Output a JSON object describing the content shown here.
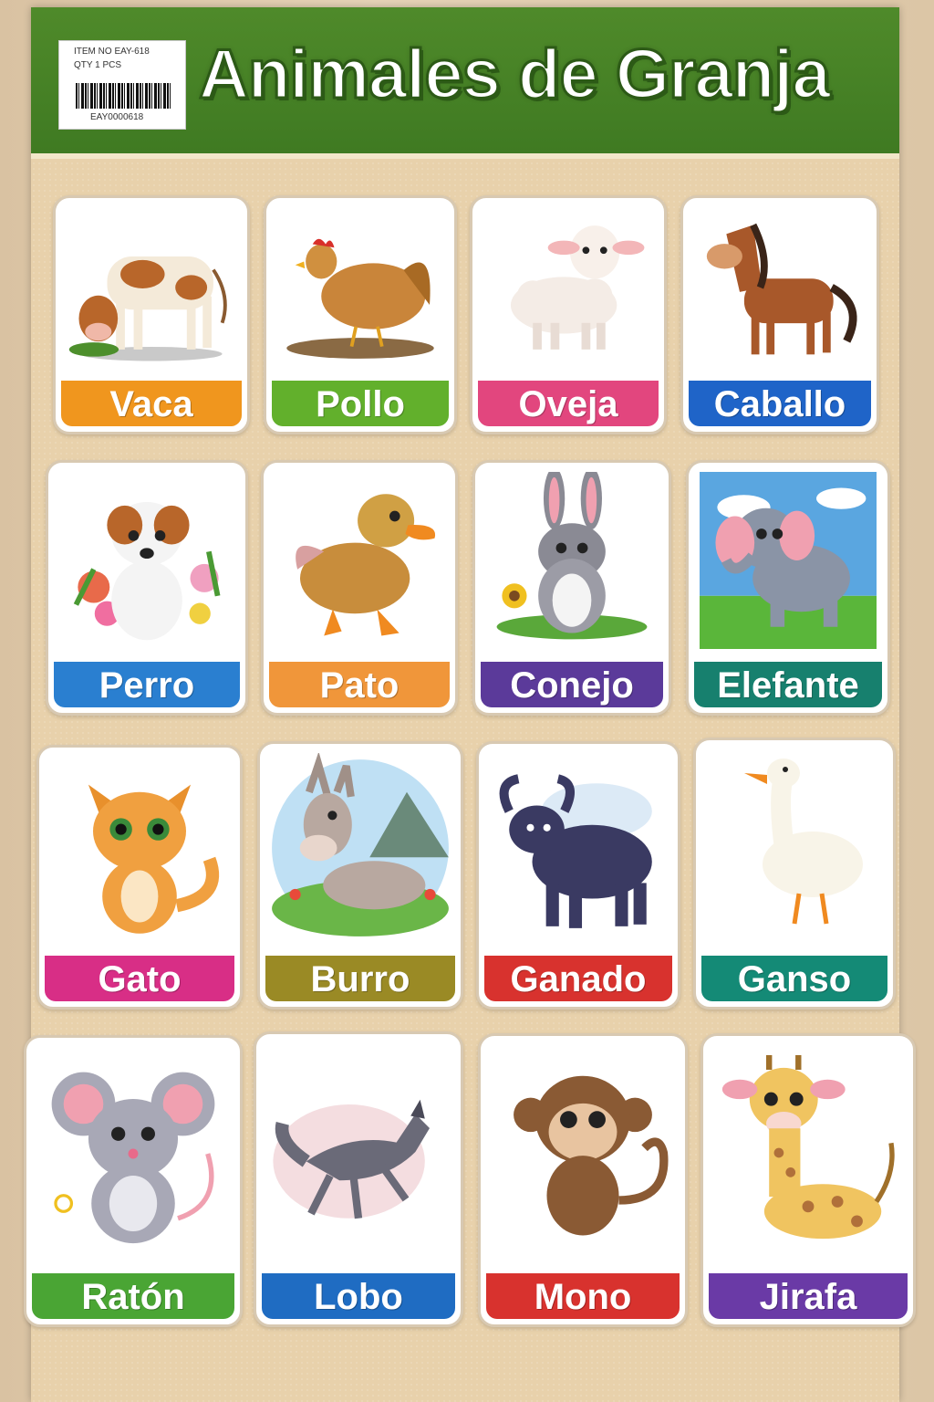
{
  "title": "Animales de Granja",
  "sticker": {
    "item_no": "ITEM NO  EAY-618",
    "qty": "QTY   1   PCS",
    "code": "EAY0000618"
  },
  "cards": [
    {
      "label": "Vaca",
      "color": "#f0961e",
      "icon": "cow-icon"
    },
    {
      "label": "Pollo",
      "color": "#62b02c",
      "icon": "chicken-icon"
    },
    {
      "label": "Oveja",
      "color": "#e2467e",
      "icon": "sheep-icon"
    },
    {
      "label": "Caballo",
      "color": "#1f64c8",
      "icon": "horse-icon"
    },
    {
      "label": "Perro",
      "color": "#2a7fd0",
      "icon": "dog-icon"
    },
    {
      "label": "Pato",
      "color": "#f0963a",
      "icon": "duck-icon"
    },
    {
      "label": "Conejo",
      "color": "#5b3a9a",
      "icon": "rabbit-icon"
    },
    {
      "label": "Elefante",
      "color": "#17806e",
      "icon": "elephant-icon"
    },
    {
      "label": "Gato",
      "color": "#d82e86",
      "icon": "cat-icon"
    },
    {
      "label": "Burro",
      "color": "#9a8a25",
      "icon": "donkey-icon"
    },
    {
      "label": "Ganado",
      "color": "#d8322e",
      "icon": "buffalo-icon"
    },
    {
      "label": "Ganso",
      "color": "#148a76",
      "icon": "goose-icon"
    },
    {
      "label": "Ratón",
      "color": "#4aa534",
      "icon": "mouse-icon"
    },
    {
      "label": "Lobo",
      "color": "#1f6cc2",
      "icon": "wolf-icon"
    },
    {
      "label": "Mono",
      "color": "#d8322e",
      "icon": "monkey-icon"
    },
    {
      "label": "Jirafa",
      "color": "#6a3aa6",
      "icon": "giraffe-icon"
    }
  ]
}
